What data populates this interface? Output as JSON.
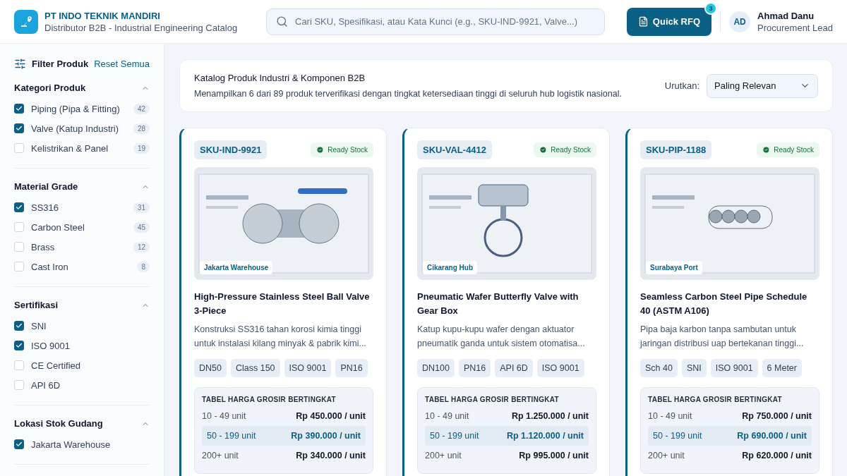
{
  "header": {
    "company": "PT INDO TEKNIK MANDIRI",
    "tagline": "Distributor B2B - Industrial Engineering Catalog",
    "search": {
      "placeholder": "Cari SKU, Spesifikasi, atau Kata Kunci (e.g., SKU-IND-9921, Valve...)"
    },
    "rfq_button": {
      "label": "Quick RFQ",
      "badge": "3"
    },
    "user": {
      "initials": "AD",
      "name": "Ahmad Danu",
      "role": "Procurement Lead"
    }
  },
  "sidebar": {
    "title": "Filter Produk",
    "reset": "Reset Semua",
    "groups": [
      {
        "title": "Kategori Produk",
        "expanded": true,
        "items": [
          {
            "label": "Piping (Pipa & Fitting)",
            "count": "42",
            "checked": true
          },
          {
            "label": "Valve (Katup Industri)",
            "count": "28",
            "checked": true
          },
          {
            "label": "Kelistrikan & Panel",
            "count": "19",
            "checked": false
          }
        ]
      },
      {
        "title": "Material Grade",
        "expanded": true,
        "items": [
          {
            "label": "SS316",
            "count": "31",
            "checked": true
          },
          {
            "label": "Carbon Steel",
            "count": "45",
            "checked": false
          },
          {
            "label": "Brass",
            "count": "12",
            "checked": false
          },
          {
            "label": "Cast Iron",
            "count": "8",
            "checked": false
          }
        ]
      },
      {
        "title": "Sertifikasi",
        "expanded": true,
        "items": [
          {
            "label": "SNI",
            "checked": true
          },
          {
            "label": "ISO 9001",
            "checked": true
          },
          {
            "label": "CE Certified",
            "checked": false
          },
          {
            "label": "API 6D",
            "checked": false
          }
        ]
      },
      {
        "title": "Lokasi Stok Gudang",
        "expanded": true,
        "items": [
          {
            "label": "Jakarta Warehouse",
            "checked": true
          }
        ]
      }
    ]
  },
  "summary": {
    "title": "Katalog Produk Industri & Komponen B2B",
    "subtitle": "Menampilkan 6 dari 89 produk terverifikasi dengan tingkat ketersediaan tinggi di seluruh hub logistik nasional.",
    "sort_label": "Urutkan:",
    "sort_value": "Paling Relevan"
  },
  "products": [
    {
      "sku": "SKU-IND-9921",
      "stock": "Ready Stock",
      "location": "Jakarta Warehouse",
      "title": "High-Pressure Stainless Steel Ball Valve 3-Piece",
      "description": "Konstruksi SS316 tahan korosi kimia tinggi untuk instalasi kilang minyak & pabrik kimi...",
      "tags": [
        "DN50",
        "Class 150",
        "ISO 9001",
        "PN16"
      ],
      "pricing": {
        "title": "TABEL HARGA GROSIR BERTINGKAT",
        "tiers": [
          {
            "qty": "10 - 49 unit",
            "price": "Rp 450.000 / unit",
            "highlighted": false
          },
          {
            "qty": "50 - 199 unit",
            "price": "Rp 390.000 / unit",
            "highlighted": true
          },
          {
            "qty": "200+ unit",
            "price": "Rp 340.000 / unit",
            "highlighted": false
          }
        ]
      }
    },
    {
      "sku": "SKU-VAL-4412",
      "stock": "Ready Stock",
      "location": "Cikarang Hub",
      "title": "Pneumatic Wafer Butterfly Valve with Gear Box",
      "description": "Katup kupu-kupu wafer dengan aktuator pneumatik ganda untuk sistem otomatisa...",
      "tags": [
        "DN100",
        "PN16",
        "API 6D",
        "ISO 9001"
      ],
      "pricing": {
        "title": "TABEL HARGA GROSIR BERTINGKAT",
        "tiers": [
          {
            "qty": "10 - 49 unit",
            "price": "Rp 1.250.000 / unit",
            "highlighted": false
          },
          {
            "qty": "50 - 199 unit",
            "price": "Rp 1.120.000 / unit",
            "highlighted": true
          },
          {
            "qty": "200+ unit",
            "price": "Rp 995.000 / unit",
            "highlighted": false
          }
        ]
      }
    },
    {
      "sku": "SKU-PIP-1188",
      "stock": "Ready Stock",
      "location": "Surabaya Port",
      "title": "Seamless Carbon Steel Pipe Schedule 40 (ASTM A106)",
      "description": "Pipa baja karbon tanpa sambutan untuk jaringan distribusi uap bertekanan tinggi...",
      "tags": [
        "Sch 40",
        "SNI",
        "ISO 9001",
        "6 Meter"
      ],
      "pricing": {
        "title": "TABEL HARGA GROSIR BERTINGKAT",
        "tiers": [
          {
            "qty": "10 - 49 unit",
            "price": "Rp 750.000 / unit",
            "highlighted": false
          },
          {
            "qty": "50 - 199 unit",
            "price": "Rp 690.000 / unit",
            "highlighted": true
          },
          {
            "qty": "200+ unit",
            "price": "Rp 620.000 / unit",
            "highlighted": false
          }
        ]
      }
    }
  ]
}
